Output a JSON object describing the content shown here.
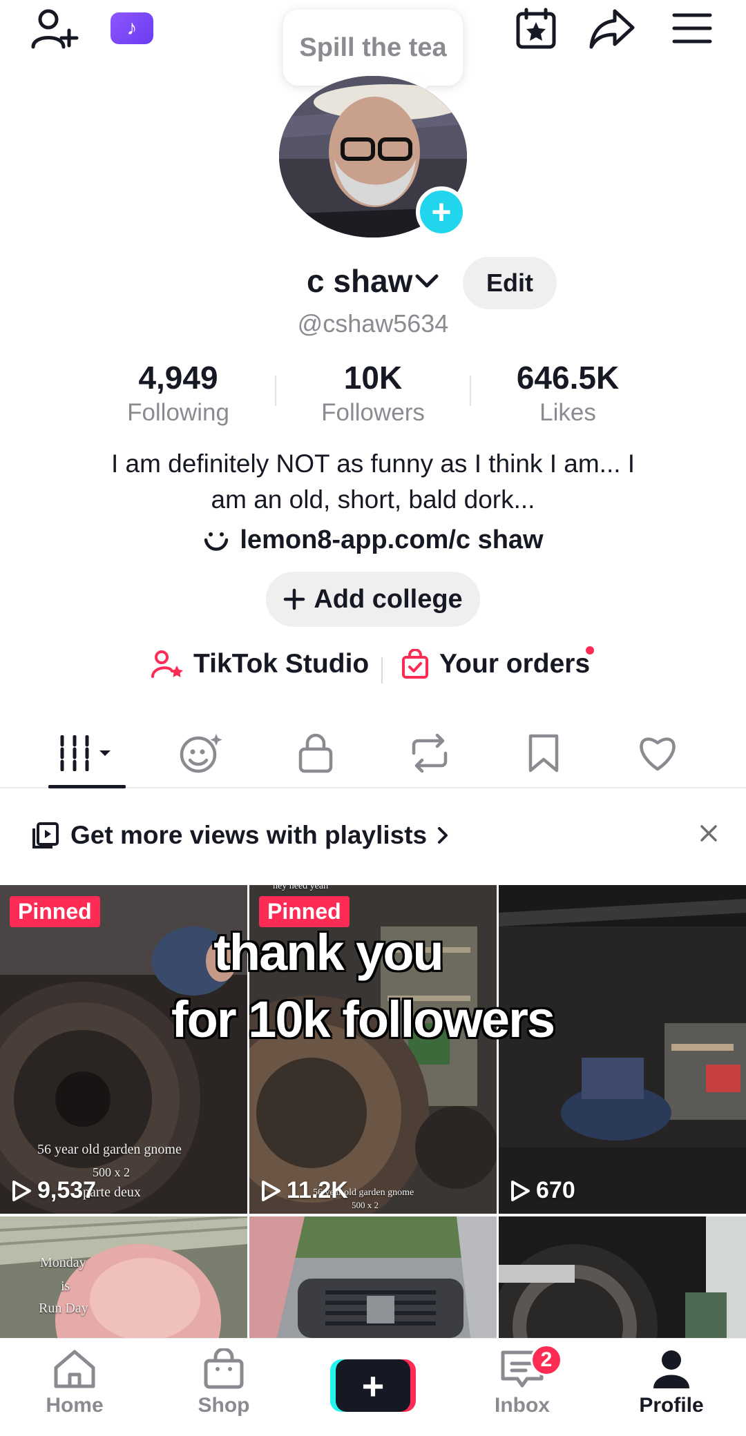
{
  "top_bar": {
    "tooltip_text": "Spill the tea",
    "tiktok_badge": "♪"
  },
  "profile": {
    "display_name": "c shaw",
    "edit_label": "Edit",
    "handle": "@cshaw5634"
  },
  "stats": [
    {
      "value": "4,949",
      "label": "Following"
    },
    {
      "value": "10K",
      "label": "Followers"
    },
    {
      "value": "646.5K",
      "label": "Likes"
    }
  ],
  "bio": {
    "line1": "I am definitely NOT as funny as I think I am... I",
    "line2": "am an old, short, bald dork...",
    "link": "lemon8-app.com/c shaw"
  },
  "add_college": {
    "label": "Add college"
  },
  "tools": {
    "studio": "TikTok Studio",
    "orders": "Your orders"
  },
  "playlist_banner": {
    "text": "Get more views with playlists"
  },
  "grid": {
    "tiles": [
      {
        "pinned": "Pinned",
        "views": "9,537",
        "caption1": "56 year old garden gnome",
        "caption2": "500 x 2",
        "caption3": "parte deux"
      },
      {
        "pinned": "Pinned",
        "views": "11.2K",
        "caption1": "56 year old garden gnome",
        "caption2": "500 x 2",
        "top_caption": "hey need yeah"
      },
      {
        "views": "670"
      },
      {
        "caption1": "Monday",
        "caption2": "is",
        "caption3": "Run Day"
      },
      {},
      {}
    ],
    "overlay_line1": "thank you",
    "overlay_line2": "for 10k followers"
  },
  "bottom_nav": {
    "home": "Home",
    "shop": "Shop",
    "inbox": "Inbox",
    "inbox_badge": "2",
    "profile": "Profile"
  },
  "colors": {
    "accent_red": "#fe2c55",
    "accent_cyan": "#20d5ec",
    "text_primary": "#161823",
    "text_secondary": "#8a8b91"
  }
}
